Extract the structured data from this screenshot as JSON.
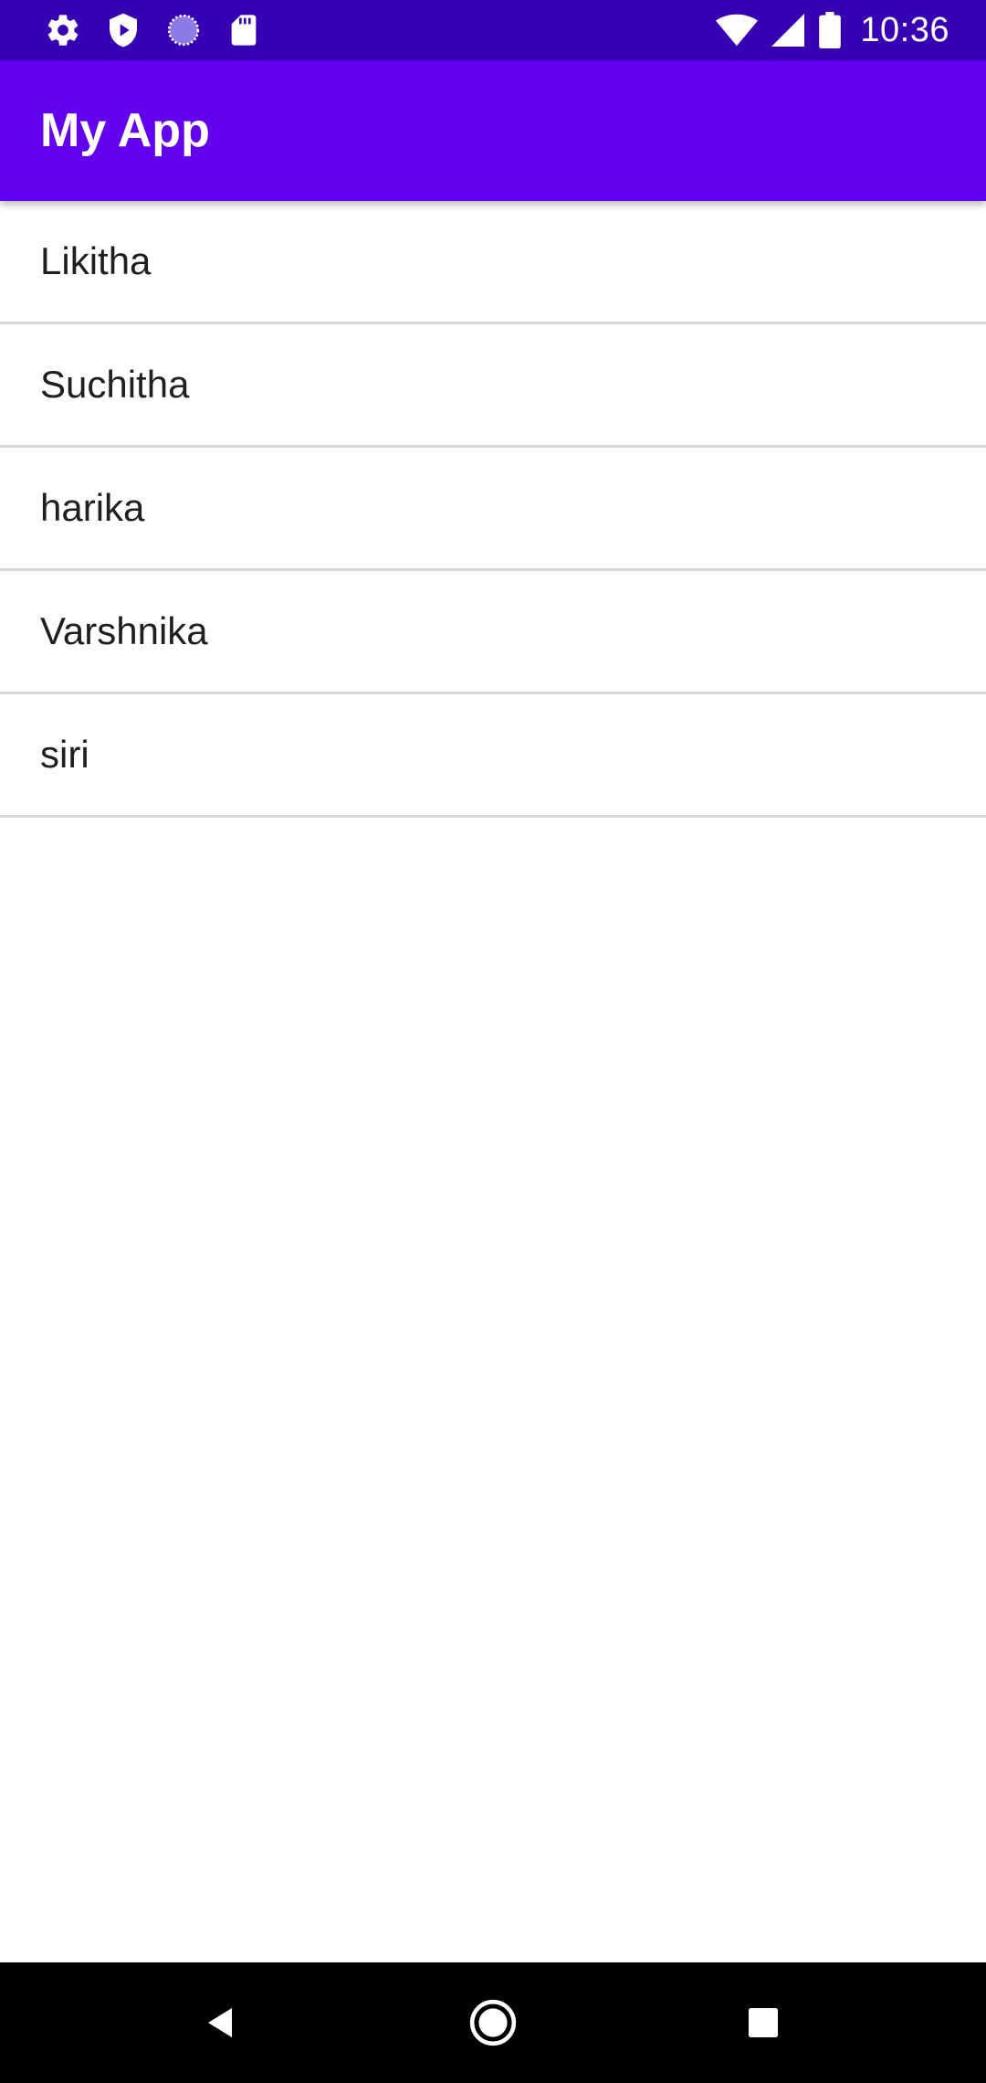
{
  "status_bar": {
    "time": "10:36",
    "left_icons": [
      "settings-icon",
      "shield-play-icon",
      "loading-circle-icon",
      "sd-card-icon"
    ],
    "right_icons": [
      "wifi-icon",
      "cell-signal-icon",
      "battery-icon"
    ],
    "background": "#3700b3"
  },
  "app_bar": {
    "title": "My App",
    "background": "#6200ee"
  },
  "list": {
    "items": [
      {
        "label": "Likitha"
      },
      {
        "label": "Suchitha"
      },
      {
        "label": "harika"
      },
      {
        "label": "Varshnika"
      },
      {
        "label": "siri"
      }
    ]
  },
  "nav_bar": {
    "buttons": [
      "back-icon",
      "home-icon",
      "recents-icon"
    ],
    "background": "#000000"
  }
}
